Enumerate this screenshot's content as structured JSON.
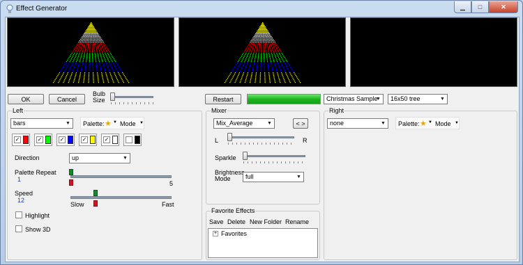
{
  "window": {
    "title": "Effect Generator"
  },
  "toolbar": {
    "ok_label": "OK",
    "cancel_label": "Cancel",
    "bulb_size_label": "Bulb Size",
    "restart_label": "Restart",
    "progress": 1.0,
    "sequence_select": "Christmas Sample",
    "model_select": "16x50 tree"
  },
  "left": {
    "group_label": "Left",
    "effect_select": "bars",
    "palette_label": "Palette:",
    "mode_label": "Mode",
    "swatches": [
      {
        "checked": true,
        "color": "#ff0000"
      },
      {
        "checked": true,
        "color": "#00ff00"
      },
      {
        "checked": true,
        "color": "#0000ff"
      },
      {
        "checked": true,
        "color": "#ffff00"
      },
      {
        "checked": true,
        "color": "#ffffff"
      },
      {
        "checked": false,
        "color": "#000000"
      }
    ],
    "direction_label": "Direction",
    "direction_value": "up",
    "palette_repeat_label": "Palette Repeat",
    "palette_repeat_value": "1",
    "palette_repeat_max": "5",
    "speed_label": "Speed",
    "speed_value": "12",
    "speed_slow": "Slow",
    "speed_fast": "Fast",
    "highlight_label": "Highlight",
    "show3d_label": "Show 3D"
  },
  "mixer": {
    "group_label": "Mixer",
    "mix_select": "Mix_Average",
    "swap_label": "< >",
    "l_label": "L",
    "r_label": "R",
    "sparkle_label": "Sparkle",
    "brightness_label": "Brightness Mode",
    "brightness_value": "full"
  },
  "favorites": {
    "group_label": "Favorite Effects",
    "save_label": "Save",
    "delete_label": "Delete",
    "new_folder_label": "New Folder",
    "rename_label": "Rename",
    "tree_root": "Favorites"
  },
  "right": {
    "group_label": "Right",
    "effect_select": "none",
    "palette_label": "Palette:",
    "mode_label": "Mode"
  },
  "tree_colors": [
    "#ffff00",
    "#ffffff",
    "#ff0000",
    "#00ff00",
    "#0000ff",
    "#ffff00"
  ]
}
